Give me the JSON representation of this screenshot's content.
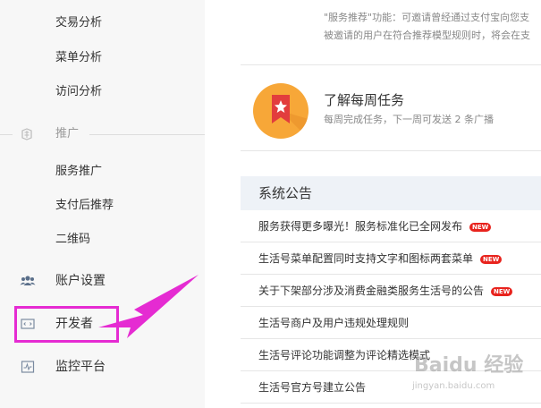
{
  "sidebar": {
    "analysis_items": [
      {
        "label": "交易分析"
      },
      {
        "label": "菜单分析"
      },
      {
        "label": "访问分析"
      }
    ],
    "promo_group": {
      "label": "推广",
      "icon": "shell-icon"
    },
    "promo_items": [
      {
        "label": "服务推广"
      },
      {
        "label": "支付后推荐"
      },
      {
        "label": "二维码"
      }
    ],
    "main_items": [
      {
        "label": "账户设置",
        "icon": "users-icon"
      },
      {
        "label": "开发者",
        "icon": "code-window-icon"
      },
      {
        "label": "监控平台",
        "icon": "monitor-chart-icon"
      }
    ],
    "highlight_color": "#e52bd2"
  },
  "content": {
    "intro_line1": "\"服务推荐\"功能：可邀请曾经通过支付宝向您支",
    "intro_line2": "被邀请的用户在符合推荐模型规则时，将会在支",
    "task": {
      "title": "了解每周任务",
      "desc": "每周完成任务，下一周可发送 2 条广播",
      "icon": "bookmark-star-icon",
      "icon_color": "#f7a738"
    },
    "notices": {
      "title": "系统公告",
      "badge_label": "NEW",
      "items": [
        {
          "text": "服务获得更多曝光！服务标准化已全网发布",
          "is_new": true
        },
        {
          "text": "生活号菜单配置同时支持文字和图标两套菜单",
          "is_new": true
        },
        {
          "text": "关于下架部分涉及消费金融类服务生活号的公告",
          "is_new": true
        },
        {
          "text": "生活号商户及用户违规处理规则",
          "is_new": false
        },
        {
          "text": "生活号评论功能调整为评论精选模式",
          "is_new": false
        },
        {
          "text": "生活号官方号建立公告",
          "is_new": false
        }
      ]
    }
  },
  "watermark": {
    "text": "Baidu 经验",
    "url": "jingyan.baidu.com"
  }
}
